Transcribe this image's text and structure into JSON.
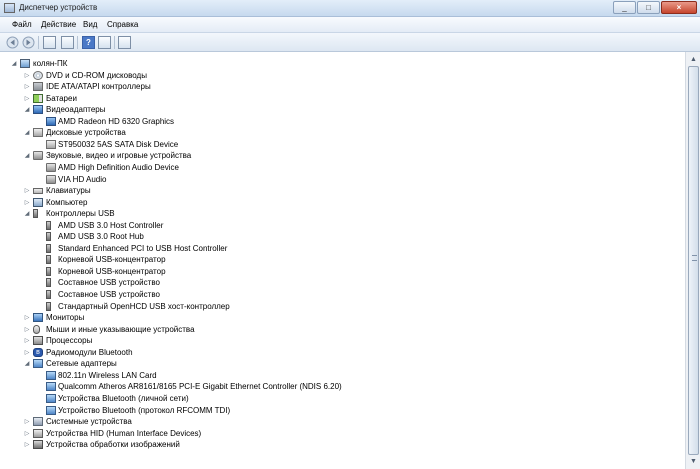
{
  "window": {
    "title": "Диспетчер устройств"
  },
  "menu": [
    "Файл",
    "Действие",
    "Вид",
    "Справка"
  ],
  "toolbar": {
    "help_label": "?"
  },
  "tree": {
    "root": "колян-ПК",
    "nodes": [
      {
        "label": "DVD и CD-ROM дисководы",
        "icon": "disc-drive-icon",
        "expanded": false
      },
      {
        "label": "IDE ATA/ATAPI контроллеры",
        "icon": "ide-controller-icon",
        "expanded": false
      },
      {
        "label": "Батареи",
        "icon": "battery-icon",
        "expanded": false
      },
      {
        "label": "Видеоадаптеры",
        "icon": "display-adapter-icon",
        "expanded": true,
        "children": [
          "AMD Radeon HD 6320 Graphics"
        ]
      },
      {
        "label": "Дисковые устройства",
        "icon": "hdd-icon",
        "expanded": true,
        "children": [
          "ST950032 5AS SATA Disk Device"
        ]
      },
      {
        "label": "Звуковые, видео и игровые устройства",
        "icon": "sound-icon",
        "expanded": true,
        "children": [
          "AMD High Definition Audio Device",
          "VIA HD Audio"
        ]
      },
      {
        "label": "Клавиатуры",
        "icon": "keyboard-icon",
        "expanded": false
      },
      {
        "label": "Компьютер",
        "icon": "computer-icon",
        "expanded": false
      },
      {
        "label": "Контроллеры USB",
        "icon": "usb-icon",
        "expanded": true,
        "children": [
          "AMD USB 3.0 Host Controller",
          "AMD USB 3.0 Root Hub",
          "Standard Enhanced PCI to USB Host Controller",
          "Корневой USB-концентратор",
          "Корневой USB-концентратор",
          "Составное USB устройство",
          "Составное USB устройство",
          "Стандартный OpenHCD USB хост-контроллер"
        ]
      },
      {
        "label": "Мониторы",
        "icon": "monitor-icon",
        "expanded": false
      },
      {
        "label": "Мыши и иные указывающие устройства",
        "icon": "mouse-icon",
        "expanded": false
      },
      {
        "label": "Процессоры",
        "icon": "cpu-icon",
        "expanded": false
      },
      {
        "label": "Радиомодули Bluetooth",
        "icon": "bluetooth-icon",
        "expanded": false
      },
      {
        "label": "Сетевые адаптеры",
        "icon": "network-adapter-icon",
        "expanded": true,
        "children": [
          "802.11n Wireless LAN Card",
          "Qualcomm Atheros AR8161/8165 PCI-E Gigabit Ethernet Controller (NDIS 6.20)",
          "Устройства Bluetooth (личной сети)",
          "Устройство Bluetooth (протокол RFCOMM TDI)"
        ]
      },
      {
        "label": "Системные устройства",
        "icon": "system-device-icon",
        "expanded": false
      },
      {
        "label": "Устройства HID (Human Interface Devices)",
        "icon": "hid-icon",
        "expanded": false
      },
      {
        "label": "Устройства обработки изображений",
        "icon": "imaging-device-icon",
        "expanded": false
      }
    ]
  }
}
